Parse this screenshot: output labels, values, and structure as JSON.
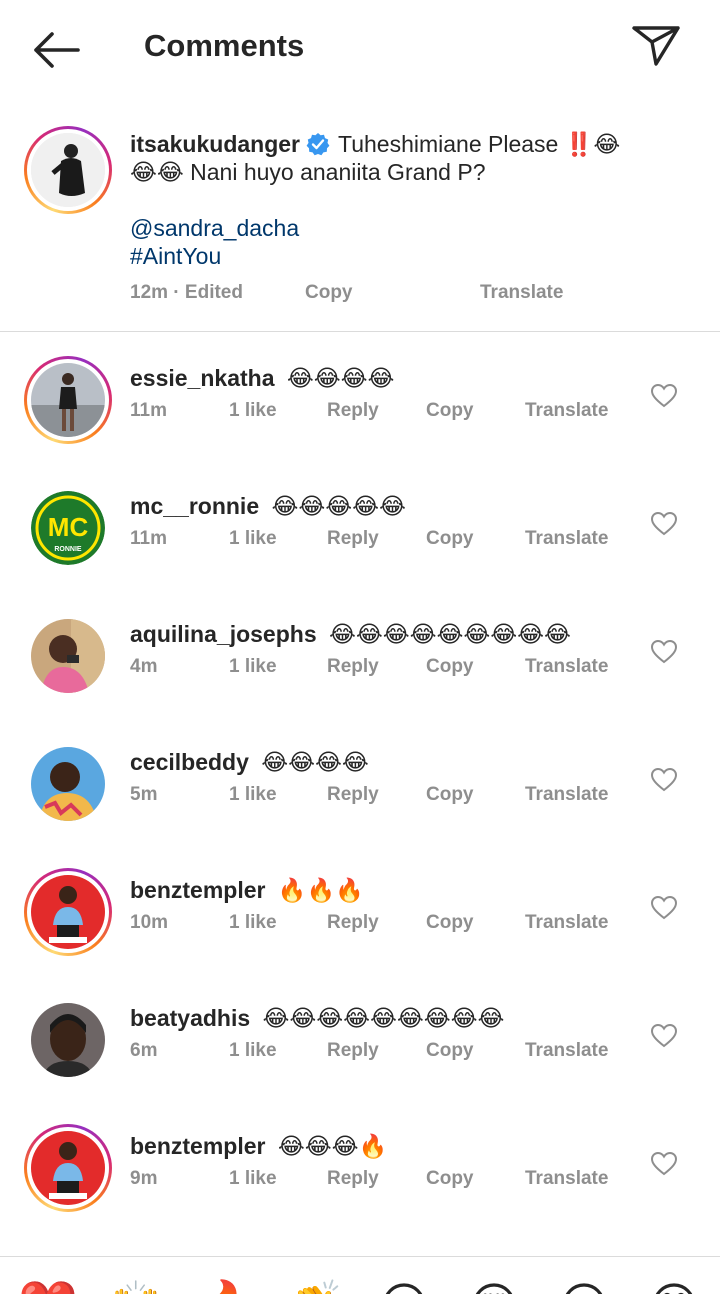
{
  "header": {
    "title": "Comments"
  },
  "caption": {
    "username": "itsakukudanger",
    "text_line1": "Tuheshimiane Please ‼️😂",
    "text_line2": "😂😂 Nani huyo ananiita Grand P?",
    "mention": "@sandra_dacha",
    "hashtag": "#AintYou",
    "time": "12m · Edited",
    "copy": "Copy",
    "translate": "Translate"
  },
  "comments": [
    {
      "username": "essie_nkatha",
      "time": "11m",
      "likes": "1 like",
      "reply": "Reply",
      "copy": "Copy",
      "translate": "Translate"
    },
    {
      "username": "mc__ronnie",
      "time": "11m",
      "likes": "1 like",
      "reply": "Reply",
      "copy": "Copy",
      "translate": "Translate"
    },
    {
      "username": "aquilina_josephs",
      "time": "4m",
      "likes": "1 like",
      "reply": "Reply",
      "copy": "Copy",
      "translate": "Translate"
    },
    {
      "username": "cecilbeddy",
      "time": "5m",
      "likes": "1 like",
      "reply": "Reply",
      "copy": "Copy",
      "translate": "Translate"
    },
    {
      "username": "benztempler",
      "time": "10m",
      "likes": "1 like",
      "reply": "Reply",
      "copy": "Copy",
      "translate": "Translate"
    },
    {
      "username": "beatyadhis",
      "time": "6m",
      "likes": "1 like",
      "reply": "Reply",
      "copy": "Copy",
      "translate": "Translate"
    },
    {
      "username": "benztempler",
      "time": "9m",
      "likes": "1 like",
      "reply": "Reply",
      "copy": "Copy",
      "translate": "Translate"
    }
  ],
  "avatars": {
    "mc_logo_text": "MC",
    "mc_logo_sub": "RONNIE"
  },
  "reactions": [
    "❤️",
    "🙌",
    "🔥",
    "👏",
    "😢",
    "😍",
    "😮",
    "😂"
  ],
  "colors": {
    "link": "#00376b",
    "muted": "#8e8e8e",
    "verified": "#3897f0",
    "text": "#262626"
  }
}
